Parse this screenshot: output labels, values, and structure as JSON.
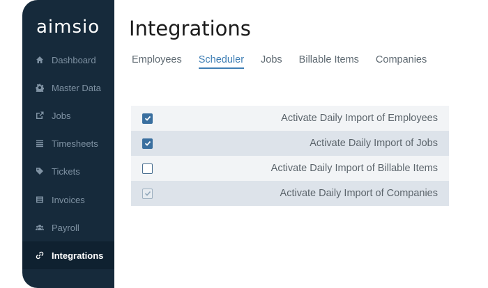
{
  "brand": {
    "logo_text": "aimsio"
  },
  "sidebar": {
    "items": [
      {
        "label": "Dashboard",
        "icon": "home-icon"
      },
      {
        "label": "Master Data",
        "icon": "gear-icon"
      },
      {
        "label": "Jobs",
        "icon": "external-link-icon"
      },
      {
        "label": "Timesheets",
        "icon": "list-icon"
      },
      {
        "label": "Tickets",
        "icon": "tag-icon"
      },
      {
        "label": "Invoices",
        "icon": "invoice-icon"
      },
      {
        "label": "Payroll",
        "icon": "users-icon"
      },
      {
        "label": "Integrations",
        "icon": "link-icon",
        "active": true
      }
    ]
  },
  "page": {
    "title": "Integrations"
  },
  "tabs": [
    {
      "label": "Employees"
    },
    {
      "label": "Scheduler",
      "active": true
    },
    {
      "label": "Jobs"
    },
    {
      "label": "Billable Items"
    },
    {
      "label": "Companies"
    }
  ],
  "settings": [
    {
      "label": "Activate Daily Import of Employees",
      "state": "checked"
    },
    {
      "label": "Activate Daily Import of Jobs",
      "state": "checked"
    },
    {
      "label": "Activate Daily Import of Billable Items",
      "state": "unchecked"
    },
    {
      "label": "Activate Daily Import of Companies",
      "state": "checked-disabled"
    }
  ],
  "colors": {
    "sidebar_bg": "#162a3b",
    "accent": "#3e7eb4",
    "checkbox_checked": "#3a6f9f"
  }
}
